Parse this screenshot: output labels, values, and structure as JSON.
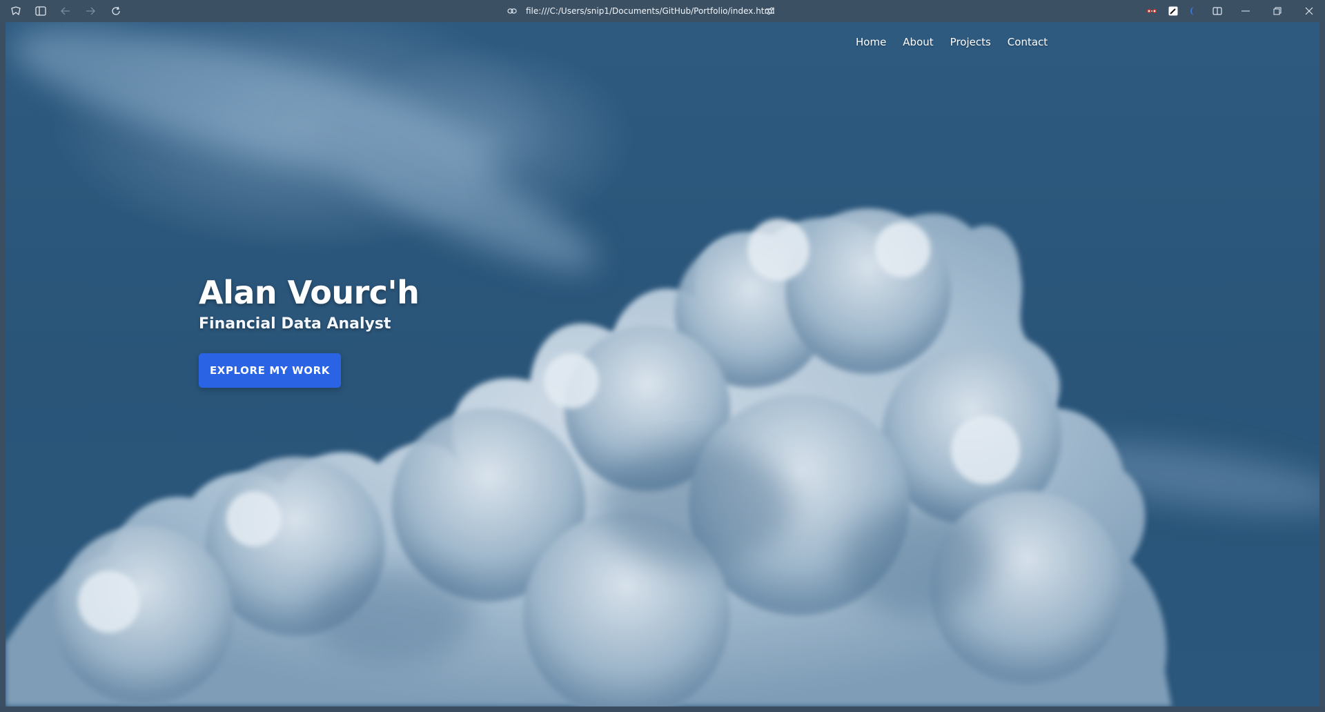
{
  "browser": {
    "url": "file:///C:/Users/snip1/Documents/GitHub/Portfolio/index.html",
    "icons": {
      "workspaces": "workspaces-icon",
      "sidebar": "sidebar-toggle-icon",
      "back": "back-arrow-icon",
      "forward": "forward-arrow-icon",
      "refresh": "refresh-icon",
      "site_info": "link-icon",
      "page_settings": "sliders-icon",
      "extension_1": "glasses-extension-icon",
      "extension_2": "pen-extension-icon",
      "extension_3": "moon-extension-icon",
      "split_view": "split-view-icon",
      "minimize": "minimize-icon",
      "restore": "restore-icon",
      "close": "close-icon"
    }
  },
  "site": {
    "nav": [
      "Home",
      "About",
      "Projects",
      "Contact"
    ],
    "hero": {
      "name": "Alan Vourc'h",
      "role": "Financial Data Analyst",
      "cta": "EXPLORE MY WORK"
    },
    "colors": {
      "sky": "#2b577c",
      "button": "#2b63e5",
      "text": "#ffffff"
    }
  }
}
